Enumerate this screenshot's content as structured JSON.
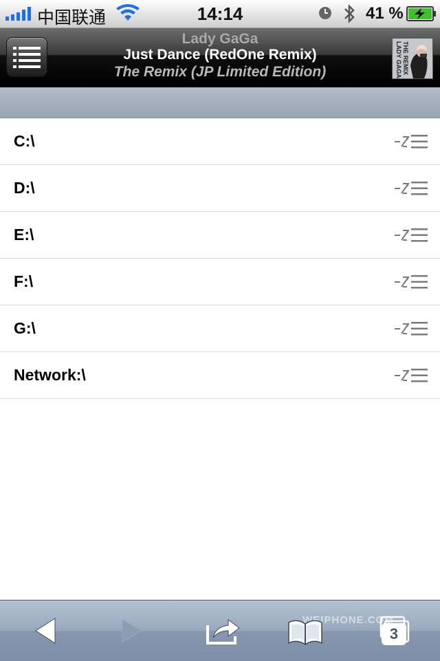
{
  "status_bar": {
    "carrier": "中国联通",
    "time": "14:14",
    "battery_percent": "41 %",
    "signal_bars": 5
  },
  "now_playing": {
    "artist": "Lady GaGa",
    "title": "Just Dance (RedOne Remix)",
    "album": "The Remix (JP Limited Edition)",
    "album_art_text": "LADY GAGA THE REMIX"
  },
  "drives": [
    {
      "label": "C:\\"
    },
    {
      "label": "D:\\"
    },
    {
      "label": "E:\\"
    },
    {
      "label": "F:\\"
    },
    {
      "label": "G:\\"
    },
    {
      "label": "Network:\\"
    }
  ],
  "toolbar": {
    "tabs_count": "3",
    "watermark": "WEIPHONE.COM"
  },
  "icons": {
    "menu": "list-menu-icon",
    "row_action": "shuffle-list-icon",
    "back": "back-arrow-icon",
    "forward": "forward-arrow-icon",
    "share": "share-icon",
    "bookmarks": "bookmarks-icon",
    "tabs": "tabs-icon"
  },
  "colors": {
    "header_bg": "#000000",
    "band": "#a6b1be",
    "toolbar": "#8e9fb5"
  }
}
